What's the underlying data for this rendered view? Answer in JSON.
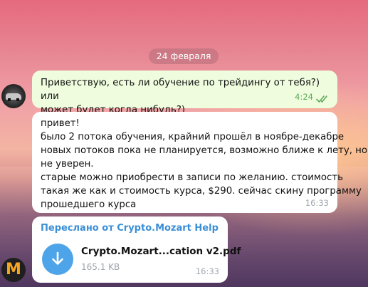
{
  "date_separator": "24 февраля",
  "outgoing_message": {
    "lines": [
      "Приветствую, есть ли обучение по трейдингу от тебя?) или",
      "может будет когда нибудь?)"
    ],
    "time": "4:24",
    "status_icon": "double-check-icon",
    "status_color": "#5fa85a"
  },
  "incoming_message": {
    "lines": [
      "привет!",
      "было 2 потока обучения, крайний прошёл в ноябре-декабре",
      "новых потоков пока не планируется, возможно ближе к лету, но",
      "не уверен.",
      "старые можно приобрести в записи по желанию. стоимость",
      "такая же как и стоимость курса, $290. сейчас скину программу",
      "прошедшего курса"
    ],
    "time": "16:33"
  },
  "forwarded_message": {
    "forwarded_label": "Переслано от Crypto.Mozart Help",
    "file_name": "Crypto.Mozart...cation v2.pdf",
    "file_size": "165.1 KB",
    "time": "16:33",
    "icon": "download-arrow-icon",
    "accent_color": "#4ea4e8"
  },
  "avatars": {
    "sender_logo_letter": "M"
  }
}
